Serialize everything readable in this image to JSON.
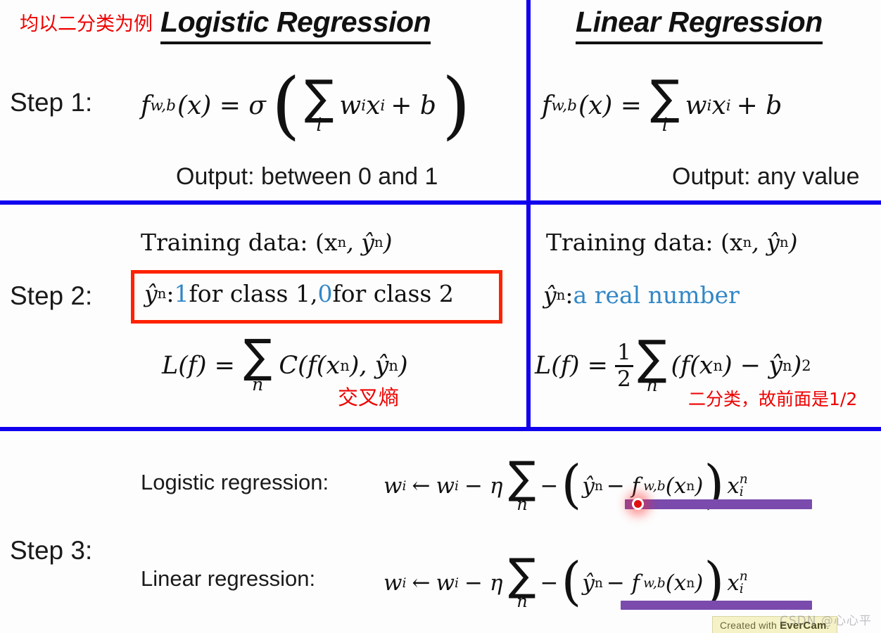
{
  "slide": {
    "annotation_top_left": "均以二分类为例",
    "columns": {
      "left_title": "Logistic Regression",
      "right_title": "Linear Regression"
    },
    "dividers": {
      "color": "#1100ee"
    },
    "step1": {
      "label": "Step 1:",
      "left": {
        "formula_f": "f",
        "formula_sub": "w,b",
        "formula_arg": "(x) = σ",
        "paren_open": "(",
        "sum_glyph": "∑",
        "sum_index": "i",
        "sum_body_w": "w",
        "sum_body_wi": "i",
        "sum_body_x": "x",
        "sum_body_xi": "i",
        "sum_body_plus": "+ b",
        "paren_close": ")",
        "output": "Output: between 0 and 1"
      },
      "right": {
        "formula_f": "f",
        "formula_sub": "w,b",
        "formula_arg": "(x) =",
        "sum_glyph": "∑",
        "sum_index": "i",
        "sum_body_w": "w",
        "sum_body_wi": "i",
        "sum_body_x": "x",
        "sum_body_xi": "i",
        "sum_body_plus": "+ b",
        "output": "Output: any value"
      }
    },
    "step2": {
      "label": "Step 2:",
      "left": {
        "training_data": "Training data: (x",
        "training_data_sup1": "n",
        "training_data_mid": ", ŷ",
        "training_data_sup2": "n",
        "training_data_end": ")",
        "highlight_yhat": "ŷ",
        "highlight_sup": "n",
        "highlight_colon": ": ",
        "highlight_one": "1",
        "highlight_text1": " for class 1, ",
        "highlight_zero": "0",
        "highlight_text2": " for class 2",
        "loss_lhs": "L(f) =",
        "sum_glyph": "∑",
        "sum_index": "n",
        "loss_rhs_c": "C(f(x",
        "loss_rhs_sup1": "n",
        "loss_rhs_mid": "), ŷ",
        "loss_rhs_sup2": "n",
        "loss_rhs_end": ")",
        "red_note": "交叉熵"
      },
      "right": {
        "training_data": "Training data: (x",
        "training_data_sup1": "n",
        "training_data_mid": ", ŷ",
        "training_data_sup2": "n",
        "training_data_end": ")",
        "yhat": "ŷ",
        "yhat_sup": "n",
        "yhat_colon": ": ",
        "yhat_value": "a real number",
        "loss_lhs": "L(f) =",
        "frac_num": "1",
        "frac_den": "2",
        "sum_glyph": "∑",
        "sum_index": "n",
        "loss_rhs_open": "(f(x",
        "loss_rhs_sup1": "n",
        "loss_rhs_minus": ") − ŷ",
        "loss_rhs_sup2": "n",
        "loss_rhs_close": ")",
        "loss_rhs_square": "2",
        "red_note": "二分类，故前面是1/2"
      }
    },
    "step3": {
      "label": "Step 3:",
      "rows": [
        {
          "name": "Logistic regression:",
          "update_w": "w",
          "update_wi": "i",
          "arrow": "←",
          "update_w2": "w",
          "update_wi2": "i",
          "minus_eta": "− η",
          "sum_glyph": "∑",
          "sum_index": "n",
          "neg": "−",
          "paren_open": "(",
          "yhat": "ŷ",
          "yhat_sup": "n",
          "inner_minus": "− f",
          "fsub": "w,b",
          "fx": "(x",
          "fx_sup": "n",
          "fx_close": ")",
          "paren_close": ")",
          "tail_x": "x",
          "tail_sub": "i",
          "tail_sup": "n",
          "has_cursor": true
        },
        {
          "name": "Linear regression:",
          "update_w": "w",
          "update_wi": "i",
          "arrow": "←",
          "update_w2": "w",
          "update_wi2": "i",
          "minus_eta": "− η",
          "sum_glyph": "∑",
          "sum_index": "n",
          "neg": "−",
          "paren_open": "(",
          "yhat": "ŷ",
          "yhat_sup": "n",
          "inner_minus": "− f",
          "fsub": "w,b",
          "fx": "(x",
          "fx_sup": "n",
          "fx_close": ")",
          "paren_close": ")",
          "tail_x": "x",
          "tail_sub": "i",
          "tail_sup": "n",
          "has_cursor": false
        }
      ]
    },
    "watermark": {
      "evercam_prefix": "Created with ",
      "evercam_brand": "EverCam",
      "evercam_suffix": ".",
      "csdn": "CSDN @心心平"
    },
    "colors": {
      "divider_blue": "#1100ee",
      "annotation_red": "#ee0000",
      "highlight_box_red": "#ff2200",
      "accent_blue": "#3287c6",
      "purple_bar": "#7a4bad"
    }
  }
}
